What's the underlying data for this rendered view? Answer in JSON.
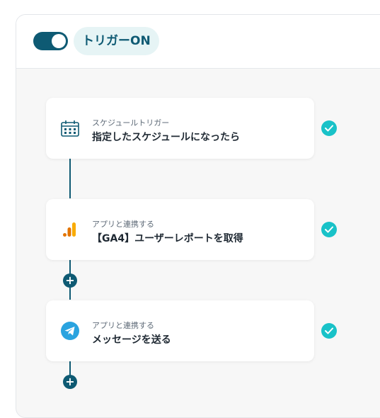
{
  "header": {
    "toggle_state": "on",
    "trigger_label": "トリガーON"
  },
  "flow": {
    "steps": [
      {
        "category": "スケジュールトリガー",
        "title": "指定したスケジュールになったら",
        "icon": "calendar-icon",
        "status": "complete"
      },
      {
        "category": "アプリと連携する",
        "title": "【GA4】ユーザーレポートを取得",
        "icon": "google-analytics-icon",
        "status": "complete"
      },
      {
        "category": "アプリと連携する",
        "title": "メッセージを送る",
        "icon": "telegram-icon",
        "status": "complete"
      }
    ],
    "add_step_symbol": "+"
  },
  "colors": {
    "primary": "#0e5a73",
    "badge_bg": "#e6f4f5",
    "check": "#19c2c8",
    "canvas_bg": "#f7f7f7"
  }
}
